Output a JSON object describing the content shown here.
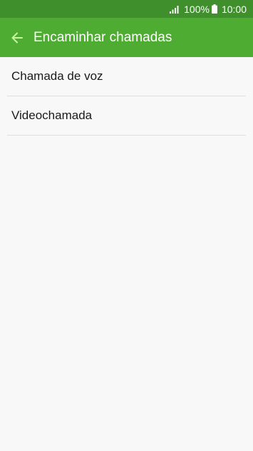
{
  "status_bar": {
    "battery_percent": "100%",
    "time": "10:00",
    "icons": [
      "signal-icon",
      "battery-icon"
    ]
  },
  "app_bar": {
    "title": "Encaminhar chamadas",
    "back_icon": "back-arrow-icon"
  },
  "list": {
    "items": [
      {
        "label": "Chamada de voz"
      },
      {
        "label": "Videochamada"
      }
    ]
  },
  "colors": {
    "status_bar_bg": "#3f8f2c",
    "app_bar_bg": "#4fac33",
    "back_arrow": "#c8f5a0",
    "page_bg": "#f8f8f8",
    "divider": "#dedede"
  }
}
